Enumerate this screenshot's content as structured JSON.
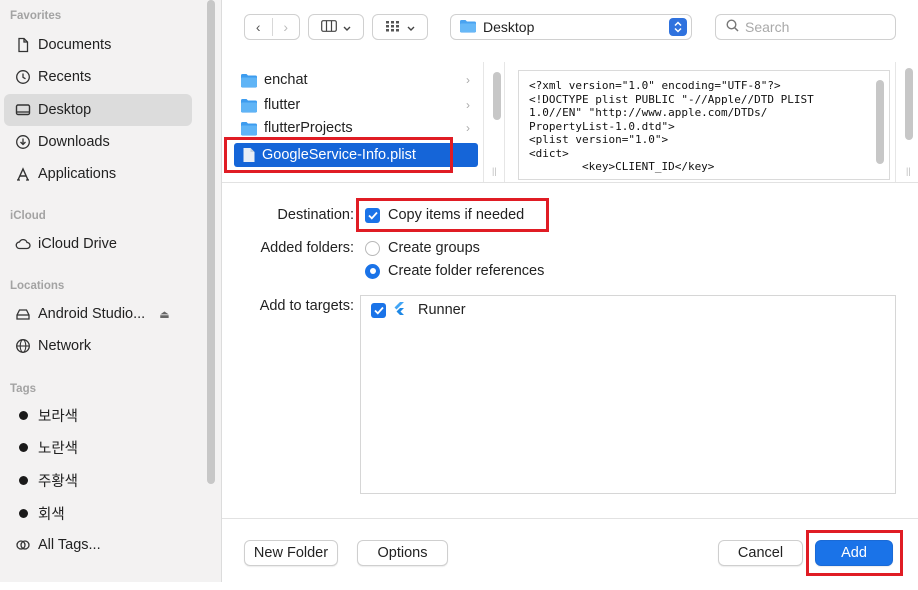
{
  "sidebar": {
    "favorites_header": "Favorites",
    "favorites": [
      {
        "label": "Documents",
        "icon": "document-icon"
      },
      {
        "label": "Recents",
        "icon": "clock-icon"
      },
      {
        "label": "Desktop",
        "icon": "desktop-icon",
        "selected": true
      },
      {
        "label": "Downloads",
        "icon": "download-icon"
      },
      {
        "label": "Applications",
        "icon": "applications-icon"
      }
    ],
    "icloud_header": "iCloud",
    "icloud": [
      {
        "label": "iCloud Drive",
        "icon": "cloud-icon"
      }
    ],
    "locations_header": "Locations",
    "locations": [
      {
        "label": "Android Studio...",
        "icon": "drive-icon"
      },
      {
        "label": "Network",
        "icon": "globe-icon"
      }
    ],
    "tags_header": "Tags",
    "tags": [
      "보라색",
      "노란색",
      "주황색",
      "회색"
    ],
    "all_tags": "All Tags..."
  },
  "toolbar": {
    "location": "Desktop",
    "search_placeholder": "Search"
  },
  "files": [
    {
      "name": "enchat",
      "type": "folder"
    },
    {
      "name": "flutter",
      "type": "folder"
    },
    {
      "name": "flutterProjects",
      "type": "folder"
    },
    {
      "name": "GoogleService-Info.plist",
      "type": "file",
      "selected": true
    }
  ],
  "preview_text": "<?xml version=\"1.0\" encoding=\"UTF-8\"?>\n<!DOCTYPE plist PUBLIC \"-//Apple//DTD PLIST\n1.0//EN\" \"http://www.apple.com/DTDs/\nPropertyList-1.0.dtd\">\n<plist version=\"1.0\">\n<dict>\n        <key>CLIENT_ID</key>",
  "options": {
    "destination_label": "Destination:",
    "copy_items_label": "Copy items if needed",
    "copy_items_checked": true,
    "added_folders_label": "Added folders:",
    "create_groups_label": "Create groups",
    "create_folder_refs_label": "Create folder references",
    "selected_folder_option": "Create folder references",
    "add_to_targets_label": "Add to targets:",
    "targets": [
      {
        "name": "Runner",
        "checked": true
      }
    ]
  },
  "buttons": {
    "new_folder": "New Folder",
    "options": "Options",
    "cancel": "Cancel",
    "add": "Add"
  },
  "colors": {
    "accent": "#1a73e8",
    "selection": "#1565d8",
    "highlight": "#e01c24",
    "folder": "#4aa3f0"
  }
}
